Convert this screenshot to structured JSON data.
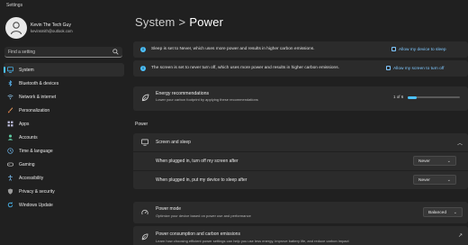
{
  "window": {
    "title": "Settings"
  },
  "profile": {
    "name": "Kevin The Tech Guy",
    "email": "kevinsmith@outlook.com"
  },
  "search": {
    "placeholder": "Find a setting"
  },
  "nav": [
    {
      "label": "System",
      "icon": "monitor-icon",
      "active": true
    },
    {
      "label": "Bluetooth & devices",
      "icon": "bluetooth-icon"
    },
    {
      "label": "Network & internet",
      "icon": "wifi-icon"
    },
    {
      "label": "Personalization",
      "icon": "brush-icon"
    },
    {
      "label": "Apps",
      "icon": "apps-icon"
    },
    {
      "label": "Accounts",
      "icon": "person-icon"
    },
    {
      "label": "Time & language",
      "icon": "globe-clock-icon"
    },
    {
      "label": "Gaming",
      "icon": "controller-icon"
    },
    {
      "label": "Accessibility",
      "icon": "accessibility-icon"
    },
    {
      "label": "Privacy & security",
      "icon": "shield-icon"
    },
    {
      "label": "Windows Update",
      "icon": "refresh-icon"
    }
  ],
  "header": {
    "section": "System",
    "separator": ">",
    "page": "Power"
  },
  "alerts": [
    {
      "text": "Sleep is set to Never, which uses more power and results in higher carbon emissions.",
      "action": "Allow my device to sleep"
    },
    {
      "text": "The screen is set to never turn off, which uses more power and results in higher carbon emissions.",
      "action": "Allow my screen to turn off"
    }
  ],
  "energy": {
    "title": "Energy recommendations",
    "subtitle": "Lower your carbon footprint by applying these recommendations",
    "progress_text": "1 of 6",
    "progress_fraction": 0.17
  },
  "power_section": {
    "label": "Power"
  },
  "screen_sleep": {
    "title": "Screen and sleep",
    "rows": [
      {
        "label": "When plugged in, turn off my screen after",
        "value": "Never"
      },
      {
        "label": "When plugged in, put my device to sleep after",
        "value": "Never"
      }
    ]
  },
  "power_mode": {
    "title": "Power mode",
    "subtitle": "Optimize your device based on power use and performance",
    "value": "Balanced"
  },
  "consumption": {
    "title": "Power consumption and carbon emissions",
    "subtitle": "Learn how choosing efficient power settings can help you use less energy, improve battery life, and reduce carbon impact"
  },
  "colors": {
    "accent": "#4cc2ff",
    "background": "#202020",
    "card": "#2b2b2b"
  }
}
